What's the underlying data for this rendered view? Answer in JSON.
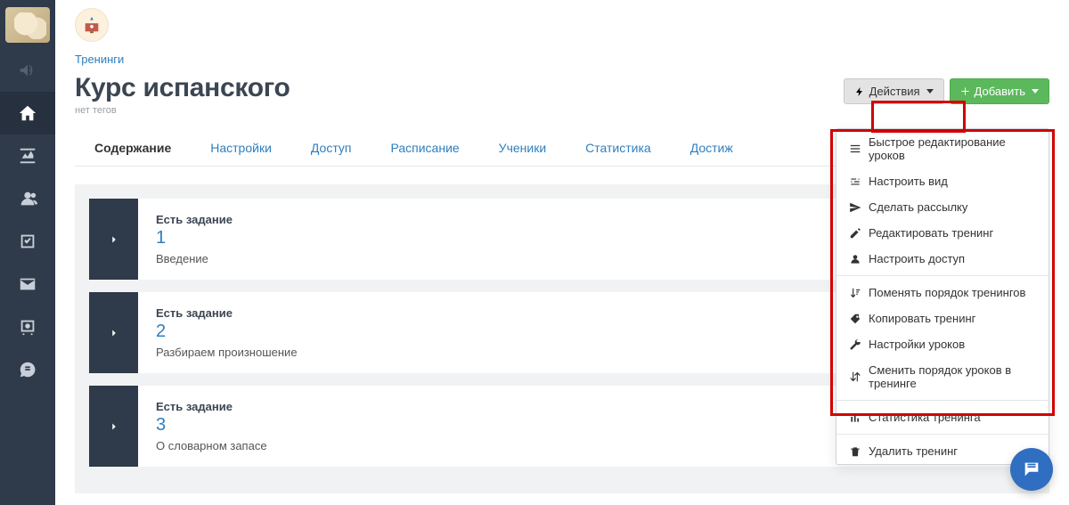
{
  "breadcrumb": {
    "trainings": "Тренинги"
  },
  "header": {
    "title": "Курс испанского",
    "no_tags": "нет тегов",
    "actions_btn": "Действия",
    "add_btn": "Добавить"
  },
  "tabs": [
    {
      "label": "Содержание",
      "active": true
    },
    {
      "label": "Настройки"
    },
    {
      "label": "Доступ"
    },
    {
      "label": "Расписание"
    },
    {
      "label": "Ученики"
    },
    {
      "label": "Статистика"
    },
    {
      "label": "Достиж"
    }
  ],
  "lessons": [
    {
      "badge": "Есть задание",
      "num": "1",
      "title": "Введение"
    },
    {
      "badge": "Есть задание",
      "num": "2",
      "title": "Разбираем произношение"
    },
    {
      "badge": "Есть задание",
      "num": "3",
      "title": "О словарном запасе"
    }
  ],
  "actions_menu": {
    "group1": [
      {
        "icon": "list",
        "label": "Быстрое редактирование уроков"
      },
      {
        "icon": "sliders",
        "label": "Настроить вид"
      },
      {
        "icon": "send",
        "label": "Сделать рассылку"
      },
      {
        "icon": "edit",
        "label": "Редактировать тренинг"
      },
      {
        "icon": "user",
        "label": "Настроить доступ"
      }
    ],
    "group2": [
      {
        "icon": "sort",
        "label": "Поменять порядок тренингов"
      },
      {
        "icon": "tag",
        "label": "Копировать тренинг"
      },
      {
        "icon": "wrench",
        "label": "Настройки уроков"
      },
      {
        "icon": "swap",
        "label": "Сменить порядок уроков в тренинге"
      }
    ],
    "group3": [
      {
        "icon": "stats",
        "label": "Статистика тренинга"
      }
    ],
    "group4": [
      {
        "icon": "trash",
        "label": "Удалить тренинг"
      }
    ]
  }
}
